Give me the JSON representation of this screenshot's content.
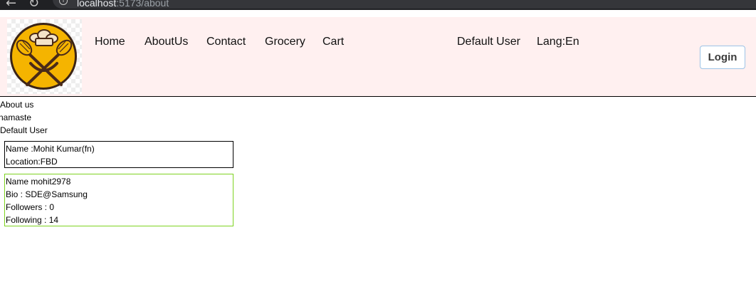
{
  "browser": {
    "url_host": "localhost",
    "url_path": ":5173/about",
    "back_glyph": "←",
    "reload_glyph": "↻",
    "info_glyph": "i"
  },
  "header": {
    "logo_name": "chef-whisk-logo",
    "logo_colors": {
      "circle": "#f5b400",
      "ring": "#3b2416",
      "utensils": "#4a2a18",
      "hat": "#f4e3c8"
    },
    "nav": [
      {
        "label": "Home"
      },
      {
        "label": "AboutUs"
      },
      {
        "label": "Contact"
      },
      {
        "label": "Grocery"
      },
      {
        "label": "Cart"
      }
    ],
    "user_label": "Default User",
    "lang_label": "Lang:En",
    "login_label": "Login"
  },
  "main": {
    "title": "About us",
    "greeting": "namaste",
    "user": "Default User",
    "class_card": {
      "name_line": "Name :Mohit Kumar(fn)",
      "location_line": "Location:FBD"
    },
    "func_card": {
      "name_line": "Name mohit2978",
      "bio_line": "Bio : SDE@Samsung",
      "followers_line": "Followers : 0",
      "following_line": "Following : 14"
    }
  }
}
